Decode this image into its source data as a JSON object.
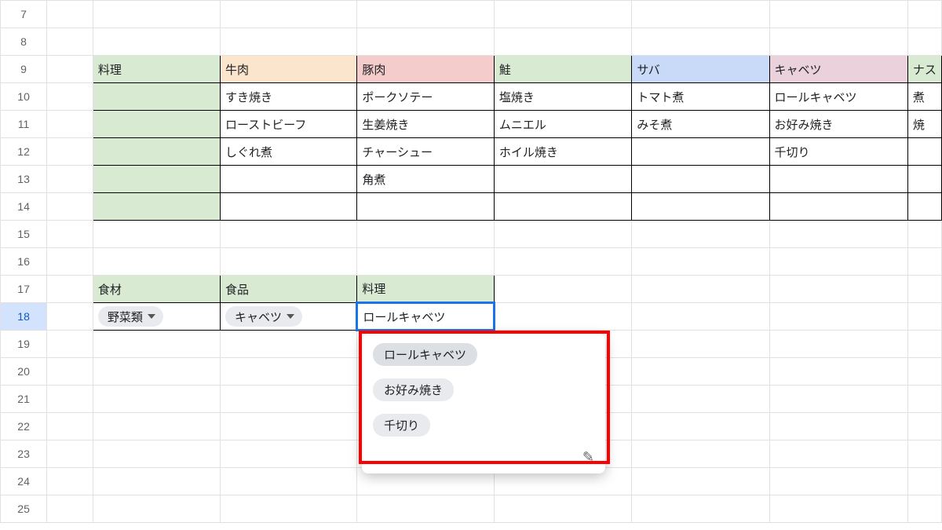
{
  "rows": [
    "7",
    "8",
    "9",
    "10",
    "11",
    "12",
    "13",
    "14",
    "15",
    "16",
    "17",
    "18",
    "19",
    "20",
    "21",
    "22",
    "23",
    "24",
    "25"
  ],
  "selected_row": "18",
  "table1": {
    "headers": [
      "料理",
      "牛肉",
      "豚肉",
      "鮭",
      "サバ",
      "キャベツ",
      "ナス"
    ],
    "rows": [
      [
        "",
        "すき焼き",
        "ポークソテー",
        "塩焼き",
        "トマト煮",
        "ロールキャベツ",
        "煮"
      ],
      [
        "",
        "ローストビーフ",
        "生姜焼き",
        "ムニエル",
        "みそ煮",
        "お好み焼き",
        "焼"
      ],
      [
        "",
        "しぐれ煮",
        "チャーシュー",
        "ホイル焼き",
        "",
        "千切り",
        ""
      ],
      [
        "",
        "",
        "角煮",
        "",
        "",
        "",
        ""
      ],
      [
        "",
        "",
        "",
        "",
        "",
        "",
        ""
      ]
    ]
  },
  "table2": {
    "headers": [
      "食材",
      "食品",
      "料理"
    ],
    "chip1": "野菜類",
    "chip2": "キャベツ",
    "active_value": "ロールキャベツ"
  },
  "dropdown": {
    "options": [
      "ロールキャベツ",
      "お好み焼き",
      "千切り"
    ],
    "edit_icon": "✎"
  },
  "chart_data": {
    "type": "table",
    "title": "料理",
    "columns": [
      "料理",
      "牛肉",
      "豚肉",
      "鮭",
      "サバ",
      "キャベツ",
      "ナス"
    ],
    "rows": [
      [
        "",
        "すき焼き",
        "ポークソテー",
        "塩焼き",
        "トマト煮",
        "ロールキャベツ",
        "煮"
      ],
      [
        "",
        "ローストビーフ",
        "生姜焼き",
        "ムニエル",
        "みそ煮",
        "お好み焼き",
        "焼"
      ],
      [
        "",
        "しぐれ煮",
        "チャーシュー",
        "ホイル焼き",
        "",
        "千切り",
        ""
      ],
      [
        "",
        "",
        "角煮",
        "",
        "",
        "",
        ""
      ],
      [
        "",
        "",
        "",
        "",
        "",
        "",
        ""
      ]
    ]
  }
}
